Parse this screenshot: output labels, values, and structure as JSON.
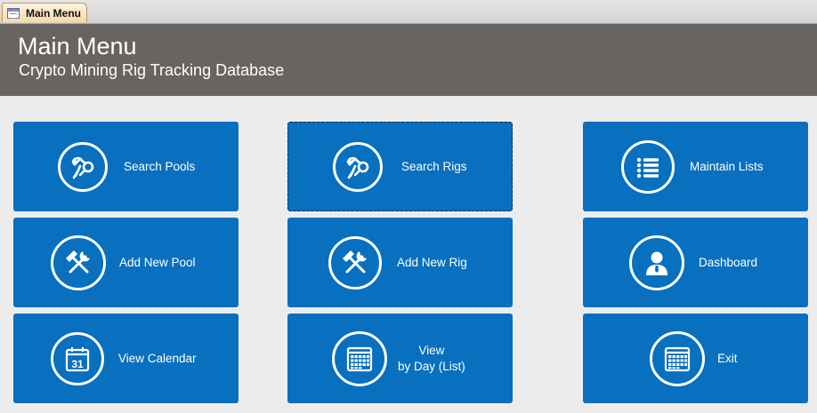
{
  "window": {
    "tab_label": "Main Menu",
    "tab_icon": "form-icon"
  },
  "header": {
    "title": "Main Menu",
    "subtitle": "Crypto Mining Rig Tracking Database",
    "background_color": "#686461"
  },
  "theme": {
    "tile_color": "#0870bf",
    "page_color": "#ececec"
  },
  "tiles": {
    "search_pools": {
      "label": "Search Pools",
      "icon": "tools-search-icon"
    },
    "search_rigs": {
      "label": "Search Rigs",
      "icon": "tools-search-icon",
      "focused": true
    },
    "maintain_lists": {
      "label": "Maintain Lists",
      "icon": "list-icon"
    },
    "add_new_pool": {
      "label": "Add New Pool",
      "icon": "hammer-wrench-icon"
    },
    "add_new_rig": {
      "label": "Add New Rig",
      "icon": "hammer-wrench-icon"
    },
    "dashboard": {
      "label": "Dashboard",
      "icon": "person-icon"
    },
    "view_calendar": {
      "label": "View Calendar",
      "icon": "calendar-31-icon"
    },
    "view_by_day": {
      "label_line1": "View",
      "label_line2": "by Day (List)",
      "icon": "calendar-grid-icon"
    },
    "exit": {
      "label": "Exit",
      "icon": "calendar-grid-icon"
    }
  }
}
